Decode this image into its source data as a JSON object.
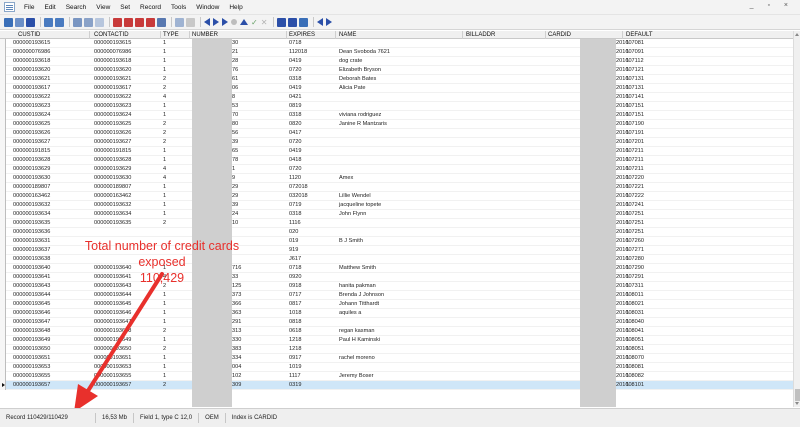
{
  "menu": {
    "items": [
      "File",
      "Edit",
      "Search",
      "View",
      "Set",
      "Record",
      "Tools",
      "Window",
      "Help"
    ],
    "window_controls": "_ ▫ ×"
  },
  "columns": [
    "CUSTID",
    "CONTACTID",
    "TYPE",
    "NUMBER",
    "EXPIRES",
    "NAME",
    "BILLADDR",
    "CARDID",
    "DEFAULT"
  ],
  "rows": [
    {
      "custid": "000000193615",
      "contactid": "000000193615",
      "type": "1",
      "number": "30",
      "expires": "0718",
      "name": "",
      "cardid": "201607081",
      "default": "1"
    },
    {
      "custid": "000000076986",
      "contactid": "000000076986",
      "type": "1",
      "number": "21",
      "expires": "112018",
      "name": "Dean Svoboda 7621",
      "cardid": "201607091",
      "default": "1"
    },
    {
      "custid": "000000193618",
      "contactid": "000000193618",
      "type": "1",
      "number": "28",
      "expires": "0419",
      "name": "dog crate",
      "cardid": "201607112",
      "default": "1"
    },
    {
      "custid": "000000193620",
      "contactid": "000000193620",
      "type": "1",
      "number": "76",
      "expires": "0720",
      "name": "Elizabeth Bryson",
      "cardid": "201607121",
      "default": "1"
    },
    {
      "custid": "000000193621",
      "contactid": "000000193621",
      "type": "2",
      "number": "61",
      "expires": "0318",
      "name": "Deborah Bates",
      "cardid": "201607131",
      "default": "1"
    },
    {
      "custid": "000000193617",
      "contactid": "000000193617",
      "type": "2",
      "number": "06",
      "expires": "0419",
      "name": "Alicia Pate",
      "cardid": "201607131",
      "default": "1"
    },
    {
      "custid": "000000193622",
      "contactid": "000000193622",
      "type": "4",
      "number": "8",
      "expires": "0421",
      "name": "",
      "cardid": "201607141",
      "default": "1"
    },
    {
      "custid": "000000193623",
      "contactid": "000000193623",
      "type": "1",
      "number": "53",
      "expires": "0819",
      "name": "",
      "cardid": "201607151",
      "default": "1"
    },
    {
      "custid": "000000193624",
      "contactid": "000000193624",
      "type": "1",
      "number": "70",
      "expires": "0318",
      "name": "viviana rodriguez",
      "cardid": "201607151",
      "default": "1"
    },
    {
      "custid": "000000193625",
      "contactid": "000000193625",
      "type": "2",
      "number": "80",
      "expires": "0820",
      "name": "Janine R Mantzaris",
      "cardid": "201607190",
      "default": "1"
    },
    {
      "custid": "000000193626",
      "contactid": "000000193626",
      "type": "2",
      "number": "56",
      "expires": "0417",
      "name": "",
      "cardid": "201607191",
      "default": "1"
    },
    {
      "custid": "000000193627",
      "contactid": "000000193627",
      "type": "2",
      "number": "39",
      "expires": "0720",
      "name": "",
      "cardid": "201607201",
      "default": "1"
    },
    {
      "custid": "000000191815",
      "contactid": "000000191815",
      "type": "1",
      "number": "65",
      "expires": "0419",
      "name": "",
      "cardid": "201607211",
      "default": "1"
    },
    {
      "custid": "000000193628",
      "contactid": "000000193628",
      "type": "1",
      "number": "78",
      "expires": "0418",
      "name": "",
      "cardid": "201607211",
      "default": "1"
    },
    {
      "custid": "000000193629",
      "contactid": "000000193629",
      "type": "4",
      "number": "1",
      "expires": "0720",
      "name": "",
      "cardid": "201607211",
      "default": "1"
    },
    {
      "custid": "000000193630",
      "contactid": "000000193630",
      "type": "4",
      "number": "9",
      "expires": "1120",
      "name": "Amex",
      "cardid": "201607220",
      "default": "1"
    },
    {
      "custid": "000000189807",
      "contactid": "000000189807",
      "type": "1",
      "number": "29",
      "expires": "072018",
      "name": "",
      "cardid": "201607221",
      "default": "1"
    },
    {
      "custid": "000000163462",
      "contactid": "000000163462",
      "type": "1",
      "number": "29",
      "expires": "032018",
      "name": "Lillie Wendel",
      "cardid": "201607222",
      "default": "1"
    },
    {
      "custid": "000000193632",
      "contactid": "000000193632",
      "type": "1",
      "number": "39",
      "expires": "0719",
      "name": "jacqueline topete",
      "cardid": "201607241",
      "default": "1"
    },
    {
      "custid": "000000193634",
      "contactid": "000000193634",
      "type": "1",
      "number": "24",
      "expires": "0318",
      "name": "John Flynn",
      "cardid": "201607251",
      "default": "1"
    },
    {
      "custid": "000000193635",
      "contactid": "000000193635",
      "type": "2",
      "number": "10",
      "expires": "1116",
      "name": "",
      "cardid": "201607251",
      "default": "1"
    },
    {
      "custid": "000000193636",
      "contactid": "",
      "type": "",
      "number": "",
      "expires": "020",
      "name": "",
      "cardid": "201607251",
      "default": "1"
    },
    {
      "custid": "000000193631",
      "contactid": "",
      "type": "",
      "number": "",
      "expires": "019",
      "name": "B J Smith",
      "cardid": "201607260",
      "default": "1"
    },
    {
      "custid": "000000193637",
      "contactid": "",
      "type": "",
      "number": "",
      "expires": "919",
      "name": "",
      "cardid": "201607271",
      "default": "1"
    },
    {
      "custid": "000000193638",
      "contactid": "",
      "type": "",
      "number": "",
      "expires": "J617",
      "name": "",
      "cardid": "201607280",
      "default": "1"
    },
    {
      "custid": "000000193640",
      "contactid": "000000193640",
      "type": "1",
      "number": "716",
      "expires": "0718",
      "name": "Matthew Smith",
      "cardid": "201607290",
      "default": "1"
    },
    {
      "custid": "000000193641",
      "contactid": "000000193641",
      "type": "4",
      "number": "33",
      "expires": "0920",
      "name": "",
      "cardid": "201607291",
      "default": "1"
    },
    {
      "custid": "000000193643",
      "contactid": "000000193643",
      "type": "2",
      "number": "125",
      "expires": "0918",
      "name": "hanita pakman",
      "cardid": "201607311",
      "default": "1"
    },
    {
      "custid": "000000193644",
      "contactid": "000000193644",
      "type": "1",
      "number": "373",
      "expires": "0717",
      "name": "Brenda J Johnson",
      "cardid": "201608011",
      "default": "1"
    },
    {
      "custid": "000000193645",
      "contactid": "000000193645",
      "type": "1",
      "number": "366",
      "expires": "0817",
      "name": "Johann Titthardt",
      "cardid": "201608021",
      "default": "1"
    },
    {
      "custid": "000000193646",
      "contactid": "000000193646",
      "type": "1",
      "number": "363",
      "expires": "1018",
      "name": "aquiles a",
      "cardid": "201608031",
      "default": "1"
    },
    {
      "custid": "000000193647",
      "contactid": "000000193647",
      "type": "1",
      "number": "291",
      "expires": "0818",
      "name": "",
      "cardid": "201608040",
      "default": "1"
    },
    {
      "custid": "000000193648",
      "contactid": "000000193648",
      "type": "2",
      "number": "313",
      "expires": "0618",
      "name": "regan kasman",
      "cardid": "201608041",
      "default": "1"
    },
    {
      "custid": "000000193649",
      "contactid": "000000193649",
      "type": "1",
      "number": "330",
      "expires": "1218",
      "name": "Paul H Kaminski",
      "cardid": "201608051",
      "default": "1"
    },
    {
      "custid": "000000193650",
      "contactid": "000000193650",
      "type": "2",
      "number": "383",
      "expires": "1218",
      "name": "",
      "cardid": "201608051",
      "default": "1"
    },
    {
      "custid": "000000193651",
      "contactid": "000000193651",
      "type": "1",
      "number": "334",
      "expires": "0917",
      "name": "rachel moreno",
      "cardid": "201608070",
      "default": "1"
    },
    {
      "custid": "000000193653",
      "contactid": "000000193653",
      "type": "1",
      "number": "004",
      "expires": "1019",
      "name": "",
      "cardid": "201608081",
      "default": "1"
    },
    {
      "custid": "000000193655",
      "contactid": "000000193655",
      "type": "1",
      "number": "102",
      "expires": "1117",
      "name": "Jeremy Boser",
      "cardid": "201608082",
      "default": "1"
    },
    {
      "custid": "000000193657",
      "contactid": "000000193657",
      "type": "2",
      "number": "309",
      "expires": "0319",
      "name": "",
      "cardid": "201608101",
      "default": "1"
    }
  ],
  "annotation": {
    "line1": "Total number of credit cards exposed",
    "line2": "110,429",
    "color": "#e8302c"
  },
  "status": {
    "record": "Record 110429/110429",
    "size": "16,53 Mb",
    "field": "Field 1, type C 12,0",
    "encoding": "OEM",
    "index": "Index is CARDID"
  },
  "colors": {
    "selection": "#cfe6f8",
    "header": "#f0f0f0",
    "toolbar_blue": "#2b4fa8",
    "toolbar_red": "#c83a3a"
  }
}
